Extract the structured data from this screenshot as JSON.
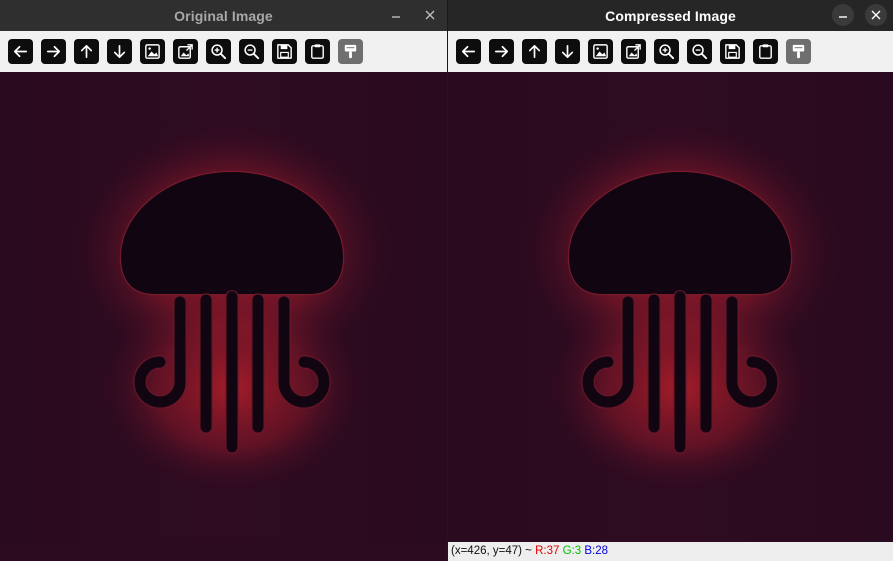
{
  "windows": [
    {
      "title": "Original Image",
      "toolbar": [
        "arrow-left",
        "arrow-right",
        "arrow-up",
        "arrow-down",
        "image-icon",
        "image-export",
        "zoom-in",
        "zoom-out",
        "save",
        "clipboard",
        "properties"
      ],
      "status": null
    },
    {
      "title": "Compressed Image",
      "toolbar": [
        "arrow-left",
        "arrow-right",
        "arrow-up",
        "arrow-down",
        "image-icon",
        "image-export",
        "zoom-in",
        "zoom-out",
        "save",
        "clipboard",
        "properties"
      ],
      "status": {
        "coords": "(x=426, y=47)",
        "sep": " ~ ",
        "r": "R:37",
        "g": "G:3",
        "b": "B:28"
      }
    }
  ],
  "colors": {
    "canvas_bg": "#2c0a1f",
    "glow": "#c0202a",
    "shape": "#120512",
    "status_r": "#e00000",
    "status_g": "#00c000",
    "status_b": "#0000e0"
  }
}
